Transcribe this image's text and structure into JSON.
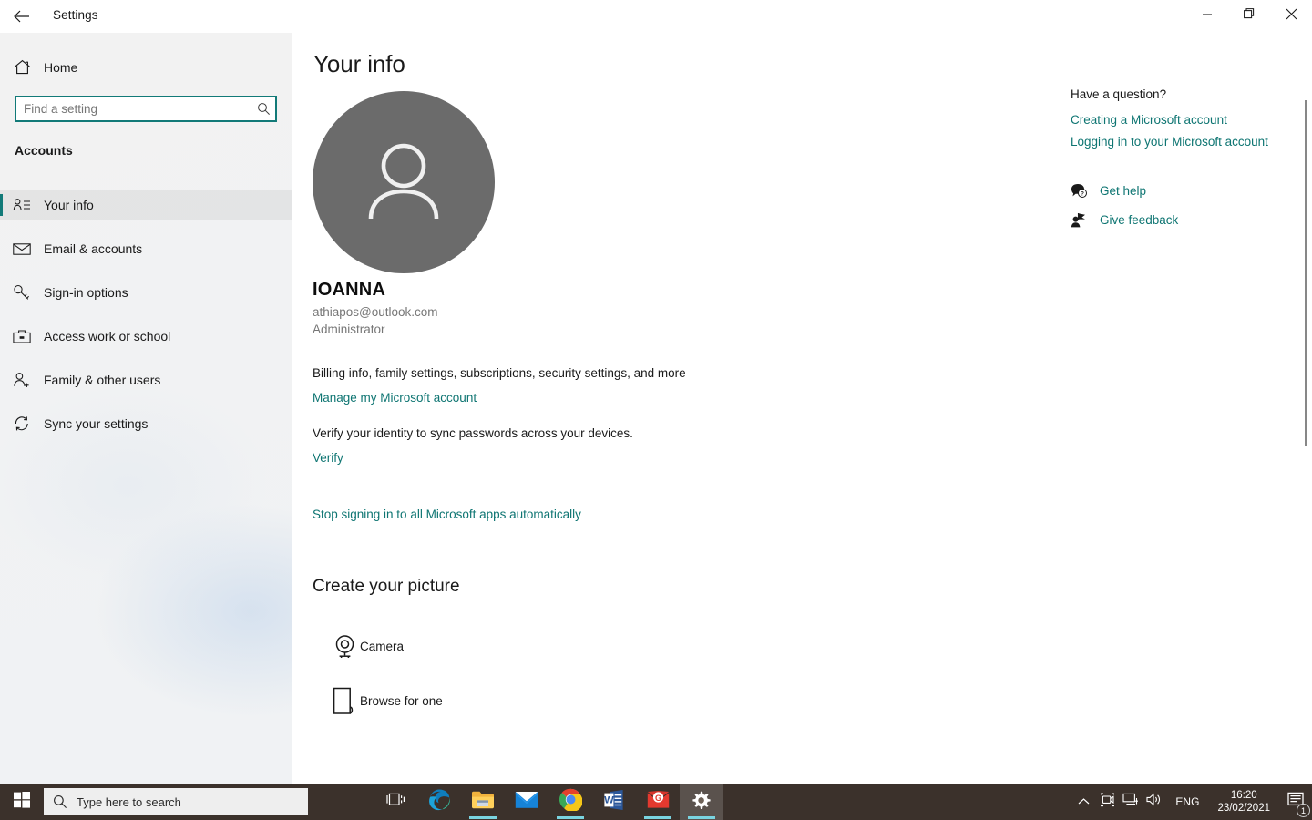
{
  "window": {
    "title": "Settings",
    "back_icon": "back-arrow-icon",
    "minimize_label": "Minimize",
    "maximize_label": "Restore",
    "close_label": "Close"
  },
  "sidebar": {
    "home_label": "Home",
    "home_icon": "home-icon",
    "search": {
      "placeholder": "Find a setting",
      "value": "",
      "icon": "search-icon"
    },
    "group_label": "Accounts",
    "items": [
      {
        "label": "Your info",
        "icon": "your-info-icon",
        "selected": true
      },
      {
        "label": "Email & accounts",
        "icon": "envelope-icon",
        "selected": false
      },
      {
        "label": "Sign-in options",
        "icon": "key-icon",
        "selected": false
      },
      {
        "label": "Access work or school",
        "icon": "briefcase-icon",
        "selected": false
      },
      {
        "label": "Family & other users",
        "icon": "person-add-icon",
        "selected": false
      },
      {
        "label": "Sync your settings",
        "icon": "sync-icon",
        "selected": false
      }
    ]
  },
  "main": {
    "page_title": "Your info",
    "avatar_icon": "default-user-avatar-icon",
    "account": {
      "name": "IOANNA",
      "email": "athiapos@outlook.com",
      "role": "Administrator"
    },
    "billing_text": "Billing info, family settings, subscriptions, security settings, and more",
    "manage_link": "Manage my Microsoft account",
    "verify_text": "Verify your identity to sync passwords across your devices.",
    "verify_link": "Verify",
    "stop_signin_link": "Stop signing in to all Microsoft apps automatically",
    "create_picture": {
      "title": "Create your picture",
      "options": [
        {
          "label": "Camera",
          "icon": "camera-icon"
        },
        {
          "label": "Browse for one",
          "icon": "browse-file-icon"
        }
      ]
    }
  },
  "help": {
    "heading": "Have a question?",
    "links": [
      "Creating a Microsoft account",
      "Logging in to your Microsoft account"
    ],
    "actions": [
      {
        "label": "Get help",
        "icon": "get-help-icon"
      },
      {
        "label": "Give feedback",
        "icon": "give-feedback-icon"
      }
    ]
  },
  "taskbar": {
    "start_icon": "windows-start-icon",
    "search": {
      "placeholder": "Type here to search",
      "icon": "search-icon"
    },
    "task_view_label": "Task View",
    "apps": [
      {
        "name": "Task View",
        "icon": "task-view-icon",
        "running": false
      },
      {
        "name": "Microsoft Edge",
        "icon": "edge-icon",
        "running": false
      },
      {
        "name": "File Explorer",
        "icon": "file-explorer-icon",
        "running": true
      },
      {
        "name": "Mail",
        "icon": "mail-icon",
        "running": false
      },
      {
        "name": "Google Chrome",
        "icon": "chrome-icon",
        "running": true
      },
      {
        "name": "Microsoft Word",
        "icon": "word-icon",
        "running": false
      },
      {
        "name": "Gmail",
        "icon": "gmail-icon",
        "running": true
      },
      {
        "name": "Settings",
        "icon": "settings-gear-icon",
        "running": true,
        "active": true
      }
    ],
    "tray": {
      "chevron_icon": "chevron-up-icon",
      "camera_icon": "camera-tray-icon",
      "network_icon": "network-icon",
      "volume_icon": "speaker-icon",
      "language": "ENG",
      "time": "16:20",
      "date": "23/02/2021",
      "notification_icon": "notification-icon",
      "notification_count": "1"
    }
  },
  "colors": {
    "accent": "#127a78",
    "link": "#0e7572",
    "taskbar": "#3b312b",
    "avatar": "#6b6b6b",
    "running_underline": "#79d4e0"
  }
}
